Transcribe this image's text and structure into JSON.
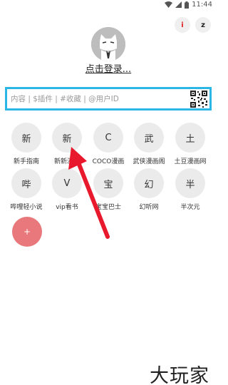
{
  "status": {
    "time": "11:44"
  },
  "top_buttons": {
    "info": "i",
    "z": "z"
  },
  "login_label": "点击登录...",
  "search": {
    "placeholder": "内容 | $插件 | #收藏 | @用户ID"
  },
  "tiles": [
    {
      "char": "新",
      "label": "新手指南"
    },
    {
      "char": "新",
      "label": "新新漫画"
    },
    {
      "char": "C",
      "label": "COCO漫画"
    },
    {
      "char": "武",
      "label": "武侠漫画阁"
    },
    {
      "char": "土",
      "label": "土豆漫画网"
    },
    {
      "char": "哔",
      "label": "哔哩轻小说"
    },
    {
      "char": "V",
      "label": "vip看书"
    },
    {
      "char": "宝",
      "label": "宝宝巴士"
    },
    {
      "char": "幻",
      "label": "幻听网"
    },
    {
      "char": "半",
      "label": "半次元"
    }
  ],
  "add_button": "+",
  "colors": {
    "accent_border": "#2bb7e6",
    "add_button": "#e8787b",
    "arrow": "#e8192c"
  },
  "icons": [
    "wifi-icon",
    "signal-icon",
    "battery-icon",
    "qr-code-icon",
    "avatar-cat-icon",
    "pointer-arrow"
  ],
  "watermark": "大玩家"
}
